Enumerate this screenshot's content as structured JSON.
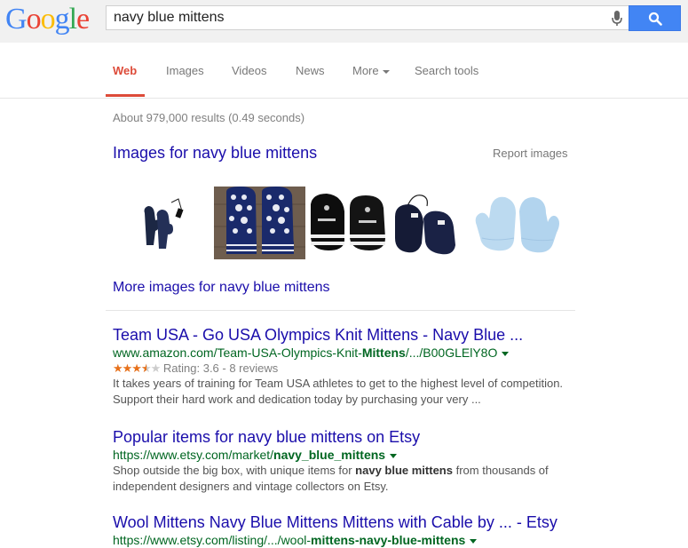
{
  "logo": {
    "letters": [
      "G",
      "o",
      "o",
      "g",
      "l",
      "e"
    ],
    "colors": [
      "#4285f4",
      "#ea4335",
      "#fbbc05",
      "#4285f4",
      "#34a853",
      "#ea4335"
    ]
  },
  "search": {
    "query": "navy blue mittens",
    "mic_icon": "microphone-icon",
    "button_icon": "magnifier-icon"
  },
  "tabs": {
    "web": "Web",
    "images": "Images",
    "videos": "Videos",
    "news": "News",
    "more": "More",
    "search_tools": "Search tools"
  },
  "stats": "About 979,000 results (0.49 seconds)",
  "images_block": {
    "heading": "Images for navy blue mittens",
    "report": "Report images",
    "more_link": "More images for navy blue mittens"
  },
  "results": [
    {
      "title": "Team USA - Go USA Olympics Knit Mittens - Navy Blue ...",
      "url_prefix": "www.amazon.com/Team-USA-Olympics-Knit-",
      "url_bold": "Mittens",
      "url_suffix": "/.../B00GLElY8O",
      "rating_text": "Rating: 3.6 - 8 reviews",
      "rating_value": 3.6,
      "snippet_1": "It takes years of training for Team USA athletes to get to the highest level of competition.",
      "snippet_2": "Support their hard work and dedication today by purchasing your very ..."
    },
    {
      "title": "Popular items for navy blue mittens on Etsy",
      "url_prefix": "https://www.etsy.com/market/",
      "url_bold": "navy_blue_mittens",
      "snippet_a": "Shop outside the big box, with unique items for ",
      "snippet_bold": "navy blue mittens",
      "snippet_b": " from thousands of",
      "snippet_2": "independent designers and vintage collectors on Etsy."
    },
    {
      "title": "Wool Mittens Navy Blue Mittens Mittens with Cable by ... - Etsy",
      "url_prefix": "https://www.etsy.com/listing/.../wool-",
      "url_bold": "mittens-navy-blue-mittens"
    }
  ]
}
